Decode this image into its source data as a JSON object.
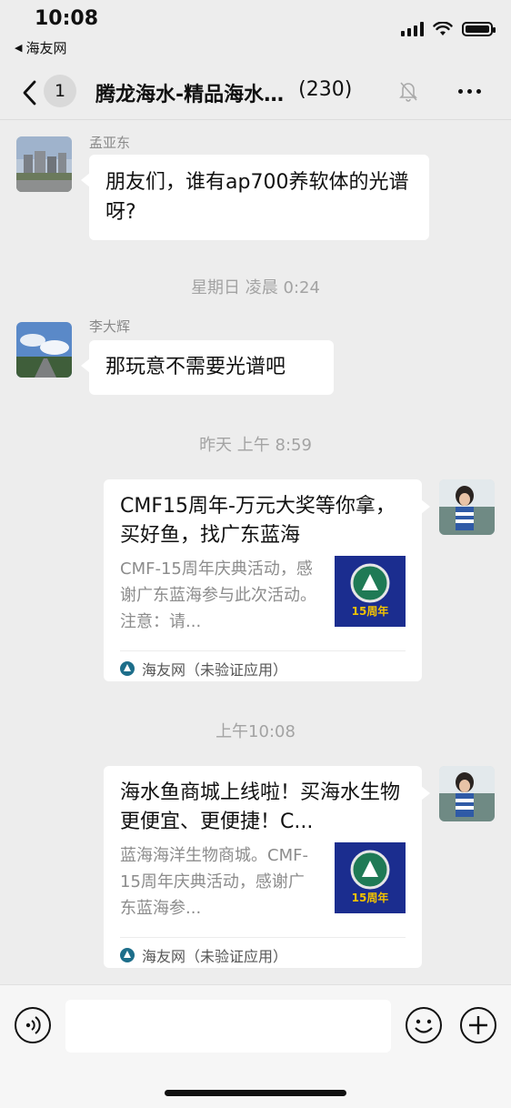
{
  "status_bar": {
    "time": "10:08",
    "back_app": "海友网"
  },
  "nav": {
    "unread_count": "1",
    "chat_title": "腾龙海水-精品海水…",
    "member_count": "(230)"
  },
  "messages": [
    {
      "sender": "孟亚东",
      "text": "朋友们，谁有ap700养软体的光谱呀?"
    },
    {
      "sender": "李大辉",
      "text": "那玩意不需要光谱吧"
    }
  ],
  "time_separators": [
    "星期日 凌晨 0:24",
    "昨天 上午 8:59",
    "上午10:08"
  ],
  "link_cards": [
    {
      "title": "CMF15周年-万元大奖等你拿，买好鱼，找广东蓝海",
      "description": "CMF-15周年庆典活动，感谢广东蓝海参与此次活动。注意：请...",
      "thumb_label": "15周年",
      "source": "海友网（未验证应用）"
    },
    {
      "title": "海水鱼商城上线啦！买海水生物更便宜、更便捷！C...",
      "description": "蓝海海洋生物商城。CMF-15周年庆典活动，感谢广东蓝海参...",
      "thumb_label": "15周年",
      "source": "海友网（未验证应用）"
    }
  ],
  "icons": {
    "back": "chevron-left-icon",
    "mute": "bell-muted-icon",
    "more": "more-dots-icon",
    "voice": "voice-icon",
    "emoji": "emoji-icon",
    "add": "plus-icon"
  }
}
